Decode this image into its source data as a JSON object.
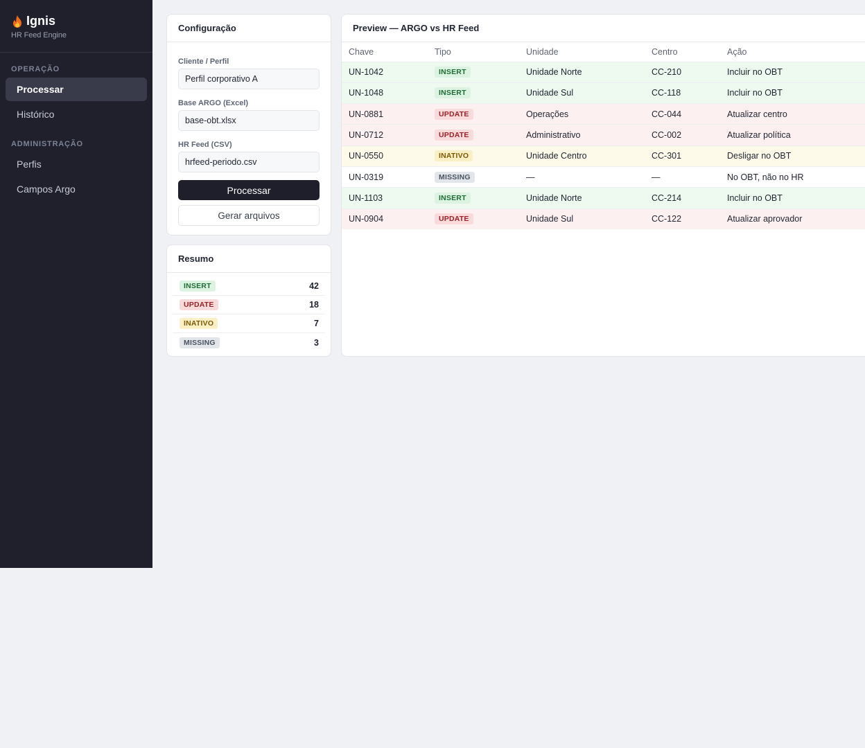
{
  "app": {
    "name": "Ignis",
    "subtitle": "HR Feed Engine"
  },
  "sidebar": {
    "sections": [
      {
        "title": "OPERAÇÃO",
        "items": [
          {
            "label": "Processar",
            "active": true
          },
          {
            "label": "Histórico"
          }
        ]
      },
      {
        "title": "ADMINISTRAÇÃO",
        "items": [
          {
            "label": "Perfis"
          },
          {
            "label": "Campos Argo"
          }
        ]
      }
    ]
  },
  "config": {
    "title": "Configuração",
    "client_label": "Cliente / Perfil",
    "client_value": "Perfil corporativo A",
    "argo_label": "Base ARGO (Excel)",
    "argo_value": "base-obt.xlsx",
    "hrfeed_label": "HR Feed (CSV)",
    "hrfeed_value": "hrfeed-periodo.csv",
    "process_button": "Processar",
    "generate_button": "Gerar arquivos"
  },
  "resumo": {
    "title": "Resumo",
    "rows": [
      {
        "type": "INSERT",
        "count": "42"
      },
      {
        "type": "UPDATE",
        "count": "18"
      },
      {
        "type": "INATIVO",
        "count": "7"
      },
      {
        "type": "MISSING",
        "count": "3"
      }
    ]
  },
  "preview": {
    "title": "Preview — ARGO vs HR Feed",
    "columns": [
      "Chave",
      "Tipo",
      "Unidade",
      "Centro",
      "Ação"
    ],
    "rows": [
      [
        "UN-1042",
        "INSERT",
        "Unidade Norte",
        "CC-210",
        "Incluir no OBT"
      ],
      [
        "UN-1048",
        "INSERT",
        "Unidade Sul",
        "CC-118",
        "Incluir no OBT"
      ],
      [
        "UN-0881",
        "UPDATE",
        "Operações",
        "CC-044",
        "Atualizar centro"
      ],
      [
        "UN-0712",
        "UPDATE",
        "Administrativo",
        "CC-002",
        "Atualizar política"
      ],
      [
        "UN-0550",
        "INATIVO",
        "Unidade Centro",
        "CC-301",
        "Desligar no OBT"
      ],
      [
        "UN-0319",
        "MISSING",
        "—",
        "—",
        "No OBT, não no HR"
      ],
      [
        "UN-1103",
        "INSERT",
        "Unidade Norte",
        "CC-214",
        "Incluir no OBT"
      ],
      [
        "UN-0904",
        "UPDATE",
        "Unidade Sul",
        "CC-122",
        "Atualizar aprovador"
      ]
    ]
  },
  "colors": {
    "sidebar_bg": "#1f202b",
    "insert": "#1f6b35",
    "update": "#9b2228",
    "inativo": "#7d5a08",
    "missing": "#4b5261"
  },
  "icons": {
    "brand": "flame-icon"
  }
}
